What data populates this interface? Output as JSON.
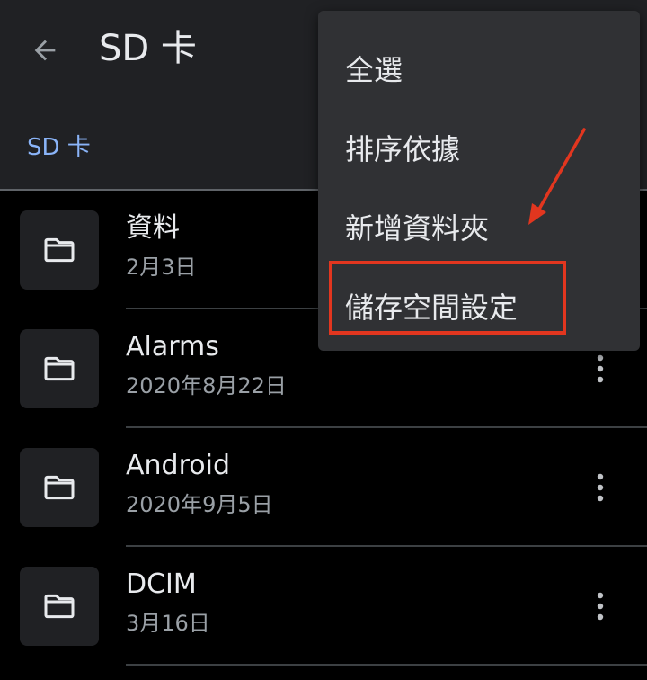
{
  "header": {
    "title": "SD 卡",
    "back_icon": "arrow-back-icon"
  },
  "breadcrumb": {
    "label": "SD 卡"
  },
  "files": [
    {
      "name": "資料",
      "date": "2月3日",
      "icon": "folder-icon",
      "has_more": false
    },
    {
      "name": "Alarms",
      "date": "2020年8月22日",
      "icon": "folder-icon",
      "has_more": true
    },
    {
      "name": "Android",
      "date": "2020年9月5日",
      "icon": "folder-icon",
      "has_more": true
    },
    {
      "name": "DCIM",
      "date": "3月16日",
      "icon": "folder-icon",
      "has_more": true
    }
  ],
  "overflow_menu": {
    "items": [
      {
        "label": "全選"
      },
      {
        "label": "排序依據"
      },
      {
        "label": "新增資料夾"
      },
      {
        "label": "儲存空間設定"
      }
    ],
    "highlighted_item": "儲存空間設定"
  },
  "colors": {
    "background": "#000000",
    "surface": "#202124",
    "menu": "#303134",
    "accent": "#8ab4f8",
    "annotation": "#e2361f"
  }
}
